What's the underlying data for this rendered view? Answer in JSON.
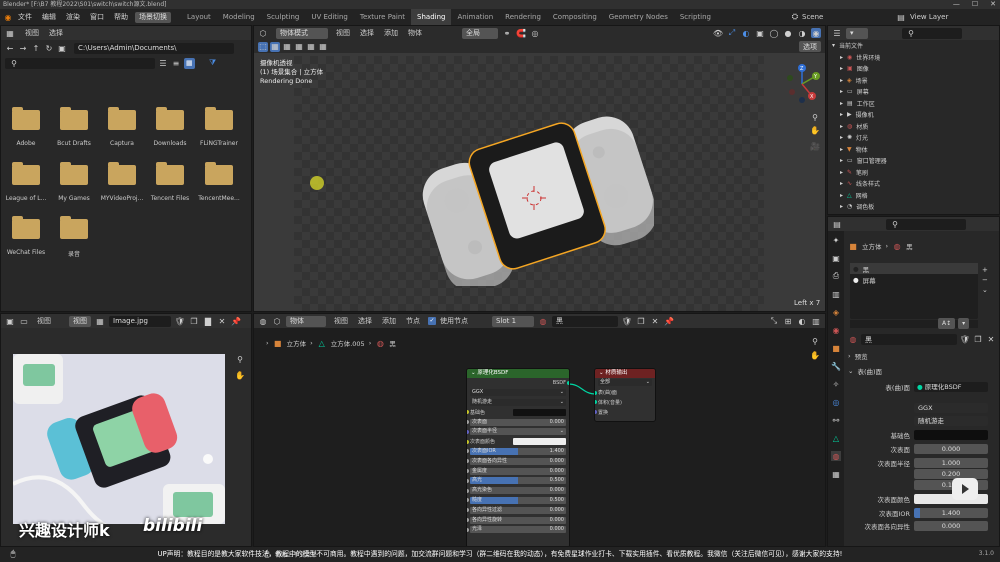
{
  "title_bar": {
    "text": "Blender* [F:\\B7 教程2022\\S01\\switch\\switch源文.blend]"
  },
  "menu": {
    "items": [
      "文件",
      "编辑",
      "渲染",
      "窗口",
      "帮助"
    ],
    "workspace_switch": "场景切换",
    "workspaces": [
      "Layout",
      "Modeling",
      "Sculpting",
      "UV Editing",
      "Texture Paint",
      "Shading",
      "Animation",
      "Rendering",
      "Compositing",
      "Geometry Nodes",
      "Scripting"
    ],
    "active_workspace": "Shading",
    "scene": "Scene",
    "view_layer": "View Layer"
  },
  "file_browser": {
    "menu": [
      "视图",
      "选择"
    ],
    "path": "C:\\Users\\Admin\\Documents\\",
    "folders": [
      "Adobe",
      "Bcut Drafts",
      "Captura",
      "Downloads",
      "FLiNGTrainer",
      "League of L...",
      "My Games",
      "MYVideoProj...",
      "Tencent Files",
      "TencentMee...",
      "WeChat Files",
      "录音"
    ]
  },
  "viewport": {
    "mode": "物体模式",
    "menu": [
      "视图",
      "选择",
      "添加",
      "物体"
    ],
    "transform": "全局",
    "overlay_title": "摄像机透视",
    "overlay_collection": "(1) 场景集合 | 立方体",
    "overlay_status": "Rendering Done",
    "options": "选项",
    "left_label": "Left x 7",
    "gizmo": {
      "z": "Z",
      "y": "Y",
      "x": "X"
    }
  },
  "outliner": {
    "title": "当前文件",
    "items": [
      "世界环境",
      "图像",
      "场景",
      "屏幕",
      "工作区",
      "摄像机",
      "材质",
      "灯光",
      "物体",
      "窗口管理器",
      "笔刷",
      "线条样式",
      "网格",
      "调色板"
    ]
  },
  "properties": {
    "breadcrumb_object": "立方体",
    "breadcrumb_material": "黑",
    "slots": [
      "黑",
      "屏幕"
    ],
    "material_name": "黑",
    "preview_label": "预览",
    "surface_label": "表(曲)面",
    "surface_field_label": "表(曲)面",
    "surface_shader": "原理化BSDF",
    "distribution": "GGX",
    "subsurface_method": "随机游走",
    "rows": [
      {
        "label": "基础色",
        "value": ""
      },
      {
        "label": "次表面",
        "value": "0.000"
      },
      {
        "label": "次表面半径",
        "value": "1.000"
      },
      {
        "label": "",
        "value": "0.200"
      },
      {
        "label": "",
        "value": "0.100"
      },
      {
        "label": "次表面颜色",
        "value": ""
      },
      {
        "label": "次表面IOR",
        "value": "1.400"
      },
      {
        "label": "次表面各向异性",
        "value": "0.000"
      }
    ]
  },
  "image_editor": {
    "menu": [
      "视图",
      "视图"
    ],
    "image_name": "Image.jpg"
  },
  "node_editor": {
    "object": "物体",
    "menu": [
      "视图",
      "选择",
      "添加",
      "节点"
    ],
    "use_nodes": "使用节点",
    "slot": "Slot 1",
    "material": "黑",
    "breadcrumb": [
      "立方体",
      "立方体.005",
      "黑"
    ],
    "bsdf_node": {
      "title": "原理化BSDF",
      "output": "BSDF",
      "distribution": "GGX",
      "method": "随机游走",
      "rows": [
        {
          "label": "基础色",
          "value": ""
        },
        {
          "label": "次表面",
          "value": "0.000"
        },
        {
          "label": "次表面半径",
          "value": ""
        },
        {
          "label": "次表面颜色",
          "value": ""
        },
        {
          "label": "次表面IOR",
          "value": "1.400"
        },
        {
          "label": "次表面各向异性",
          "value": "0.000"
        },
        {
          "label": "金属度",
          "value": "0.000"
        },
        {
          "label": "高光",
          "value": "0.500"
        },
        {
          "label": "高光染色",
          "value": "0.000"
        },
        {
          "label": "糙度",
          "value": "0.500"
        },
        {
          "label": "各向异性过滤",
          "value": "0.000"
        },
        {
          "label": "各向异性旋转",
          "value": "0.000"
        },
        {
          "label": "光泽",
          "value": "0.000"
        }
      ]
    },
    "output_node": {
      "title": "材质输出",
      "target": "全部",
      "rows": [
        "表(曲)面",
        "体积(音量)",
        "置换"
      ]
    }
  },
  "status": {
    "hint": "物体上下文菜单",
    "version": "3.1.0"
  },
  "subtitle": "UP声明：教程目的是教大家软件技法，教程中的模型不可商用。教程中遇到的问题，加交流群问题和学习（群二维码在我的动态），有免费星球作业打卡、下载实用插件、看优质教程。我微信（关注后微信可见），感谢大家的支持!",
  "watermark": {
    "author": "兴趣设计师k",
    "site": "bilibili"
  },
  "colors": {
    "accent": "#4772b3",
    "selection": "#f5a623",
    "bsdf_header": "#2b652b",
    "output_header": "#6e2222"
  }
}
